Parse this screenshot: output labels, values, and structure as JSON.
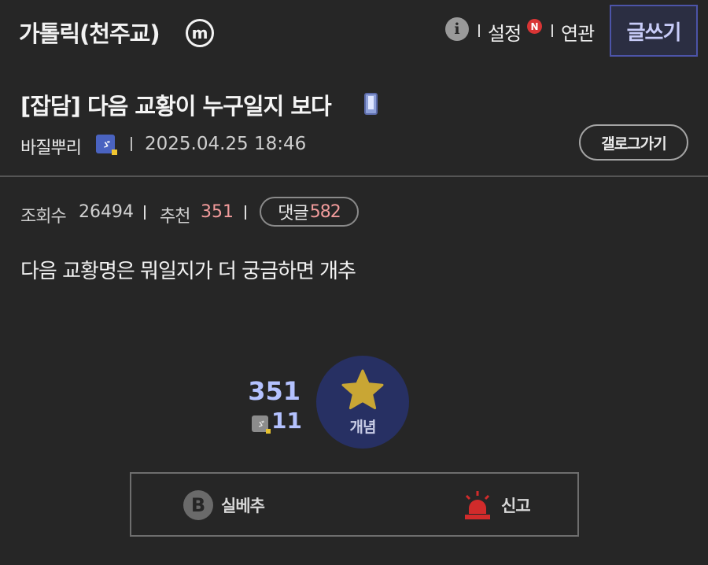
{
  "header": {
    "gallery_title": "가톨릭(천주교)",
    "minor_badge": "m",
    "info_icon": "i",
    "settings_label": "설정",
    "new_badge": "N",
    "related_label": "연관",
    "write_label": "글쓰기"
  },
  "post": {
    "title": "[잡담] 다음 교황이 누구일지 보다",
    "author": "바질뿌리",
    "date": "2025.04.25 18:46",
    "gallery_button": "갤로그가기",
    "views_label": "조회수",
    "views": "26494",
    "recommend_label": "추천",
    "recommend": "351",
    "comments_label": "댓글",
    "comments": "582",
    "body": "다음 교황명은 뭐일지가 더 궁금하면 개추"
  },
  "recommend_block": {
    "count": "351",
    "fixed_count": "11",
    "button_label": "개념",
    "downvote_label": "실베추",
    "downvote_icon": "B",
    "report_label": "신고"
  },
  "icons": {
    "info": "info-icon",
    "minor": "minor-gallery-icon",
    "mobile": "mobile-icon",
    "user": "fixed-nick-icon",
    "star": "star-icon",
    "siren": "siren-icon"
  },
  "colors": {
    "background": "#262626",
    "accent": "#b4c2ff",
    "highlight_count": "#f19b9b",
    "recommend_button": "#273063",
    "star": "#c9a634",
    "siren": "#d12b2b"
  }
}
